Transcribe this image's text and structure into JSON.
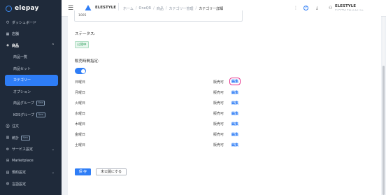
{
  "app": {
    "name": "elepay"
  },
  "sidebar": {
    "items": [
      {
        "label": "ダッシュボード",
        "icon": "clock-icon"
      },
      {
        "label": "店舗",
        "icon": "store-icon"
      },
      {
        "label": "商品",
        "icon": "tag-icon"
      },
      {
        "label": "商品一覧"
      },
      {
        "label": "商品セット"
      },
      {
        "label": "カテゴリー"
      },
      {
        "label": "オプション"
      },
      {
        "label": "商品グループ",
        "badge": "New"
      },
      {
        "label": "KDSグループ",
        "badge": "New"
      },
      {
        "label": "注文",
        "icon": "cart-icon"
      },
      {
        "label": "統計",
        "icon": "chart-icon",
        "badge": "New"
      },
      {
        "label": "サービス設定",
        "icon": "gear-icon"
      },
      {
        "label": "Marketplace",
        "icon": "grid-icon"
      },
      {
        "label": "規約設定",
        "icon": "document-icon"
      },
      {
        "label": "言語設定",
        "icon": "globe-icon"
      }
    ]
  },
  "topbar": {
    "store_name": "ELESTYLE",
    "breadcrumb": [
      "ホーム",
      "OneQR",
      "商品",
      "カテゴリー管理",
      "カテゴリー詳細"
    ],
    "user_name": "ELESTYLE",
    "user_company": "ELESTYLE株式会社(本..."
  },
  "form": {
    "sku_value": "1005",
    "status_label": "ステータス:",
    "status_value": "公開中",
    "sales_time_label": "販売時間指定:",
    "days": [
      {
        "day": "日曜日",
        "status": "販売可",
        "edit": "編集"
      },
      {
        "day": "月曜日",
        "status": "販売可",
        "edit": "編集"
      },
      {
        "day": "火曜日",
        "status": "販売可",
        "edit": "編集"
      },
      {
        "day": "水曜日",
        "status": "販売可",
        "edit": "編集"
      },
      {
        "day": "木曜日",
        "status": "販売可",
        "edit": "編集"
      },
      {
        "day": "金曜日",
        "status": "販売可",
        "edit": "編集"
      },
      {
        "day": "土曜日",
        "status": "販売可",
        "edit": "編集"
      }
    ],
    "save_label": "保 存",
    "unpublish_label": "未公開にする"
  },
  "colors": {
    "accent": "#2e7df6",
    "sidebar_bg": "#1f2a3a",
    "highlight": "#e5338c",
    "status_green": "#2b9d5a"
  }
}
